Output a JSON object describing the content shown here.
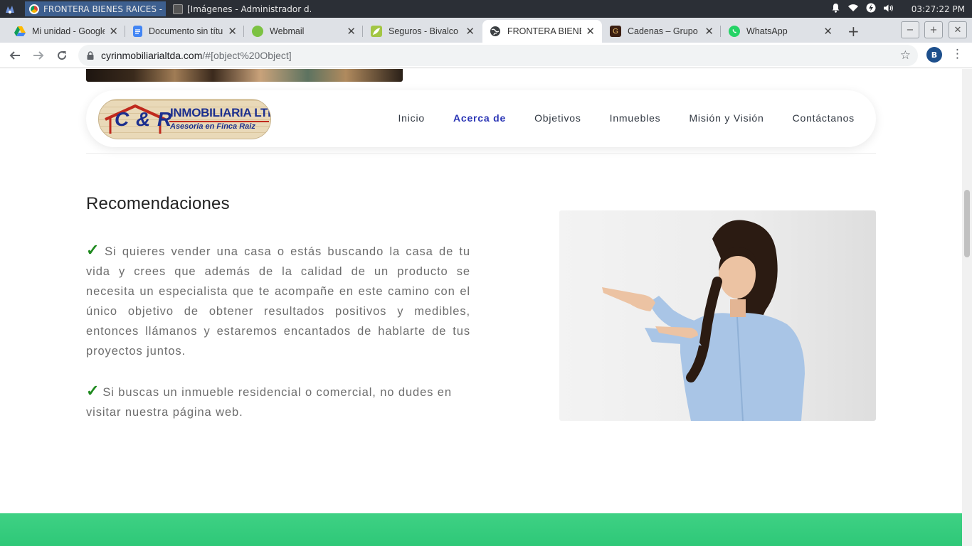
{
  "taskbar": {
    "tasks": [
      {
        "label": "FRONTERA BIENES RAICES - ..."
      },
      {
        "label": "[Imágenes - Administrador d..."
      }
    ],
    "clock": "03:27:22 PM"
  },
  "browser": {
    "tabs": [
      {
        "label": "Mi unidad - Google",
        "icon": "google-drive-icon"
      },
      {
        "label": "Documento sin títu",
        "icon": "google-docs-icon"
      },
      {
        "label": "Webmail",
        "icon": "webmail-icon"
      },
      {
        "label": "Seguros - Bivalco",
        "icon": "bivalco-icon"
      },
      {
        "label": "FRONTERA BIENES",
        "icon": "globe-icon"
      },
      {
        "label": "Cadenas – Grupo",
        "icon": "grupo-icon"
      },
      {
        "label": "WhatsApp",
        "icon": "whatsapp-icon"
      }
    ],
    "active_tab": 4,
    "url_host": "cyrinmobiliarialtda.com",
    "url_path": "/#[object%20Object]",
    "profile_initials": "B"
  },
  "site": {
    "logo": {
      "initials": "C & R",
      "name": "INMOBILIARIA LTDA.",
      "tagline": "Asesoria en Finca Raiz"
    },
    "menu": [
      {
        "label": "Inicio",
        "active": false
      },
      {
        "label": "Acerca de",
        "active": true
      },
      {
        "label": "Objetivos",
        "active": false
      },
      {
        "label": "Inmuebles",
        "active": false
      },
      {
        "label": "Misión y Visión",
        "active": false
      },
      {
        "label": "Contáctanos",
        "active": false
      }
    ],
    "section_title": "Recomendaciones",
    "paragraphs": [
      "Si quieres vender una casa o estás buscando la casa de tu vida y crees que además de la calidad de un producto se necesita un especialista que te acompañe en este camino con el único objetivo de obtener resultados positivos y medibles, entonces llámanos y estaremos encantados de hablarte de tus proyectos juntos.",
      "Si buscas un inmueble residencial o comercial, no dudes en visitar nuestra página web."
    ],
    "accent_color": "#2a35b5",
    "check_color": "#1f8a1f",
    "band_color": "#2ec878"
  }
}
